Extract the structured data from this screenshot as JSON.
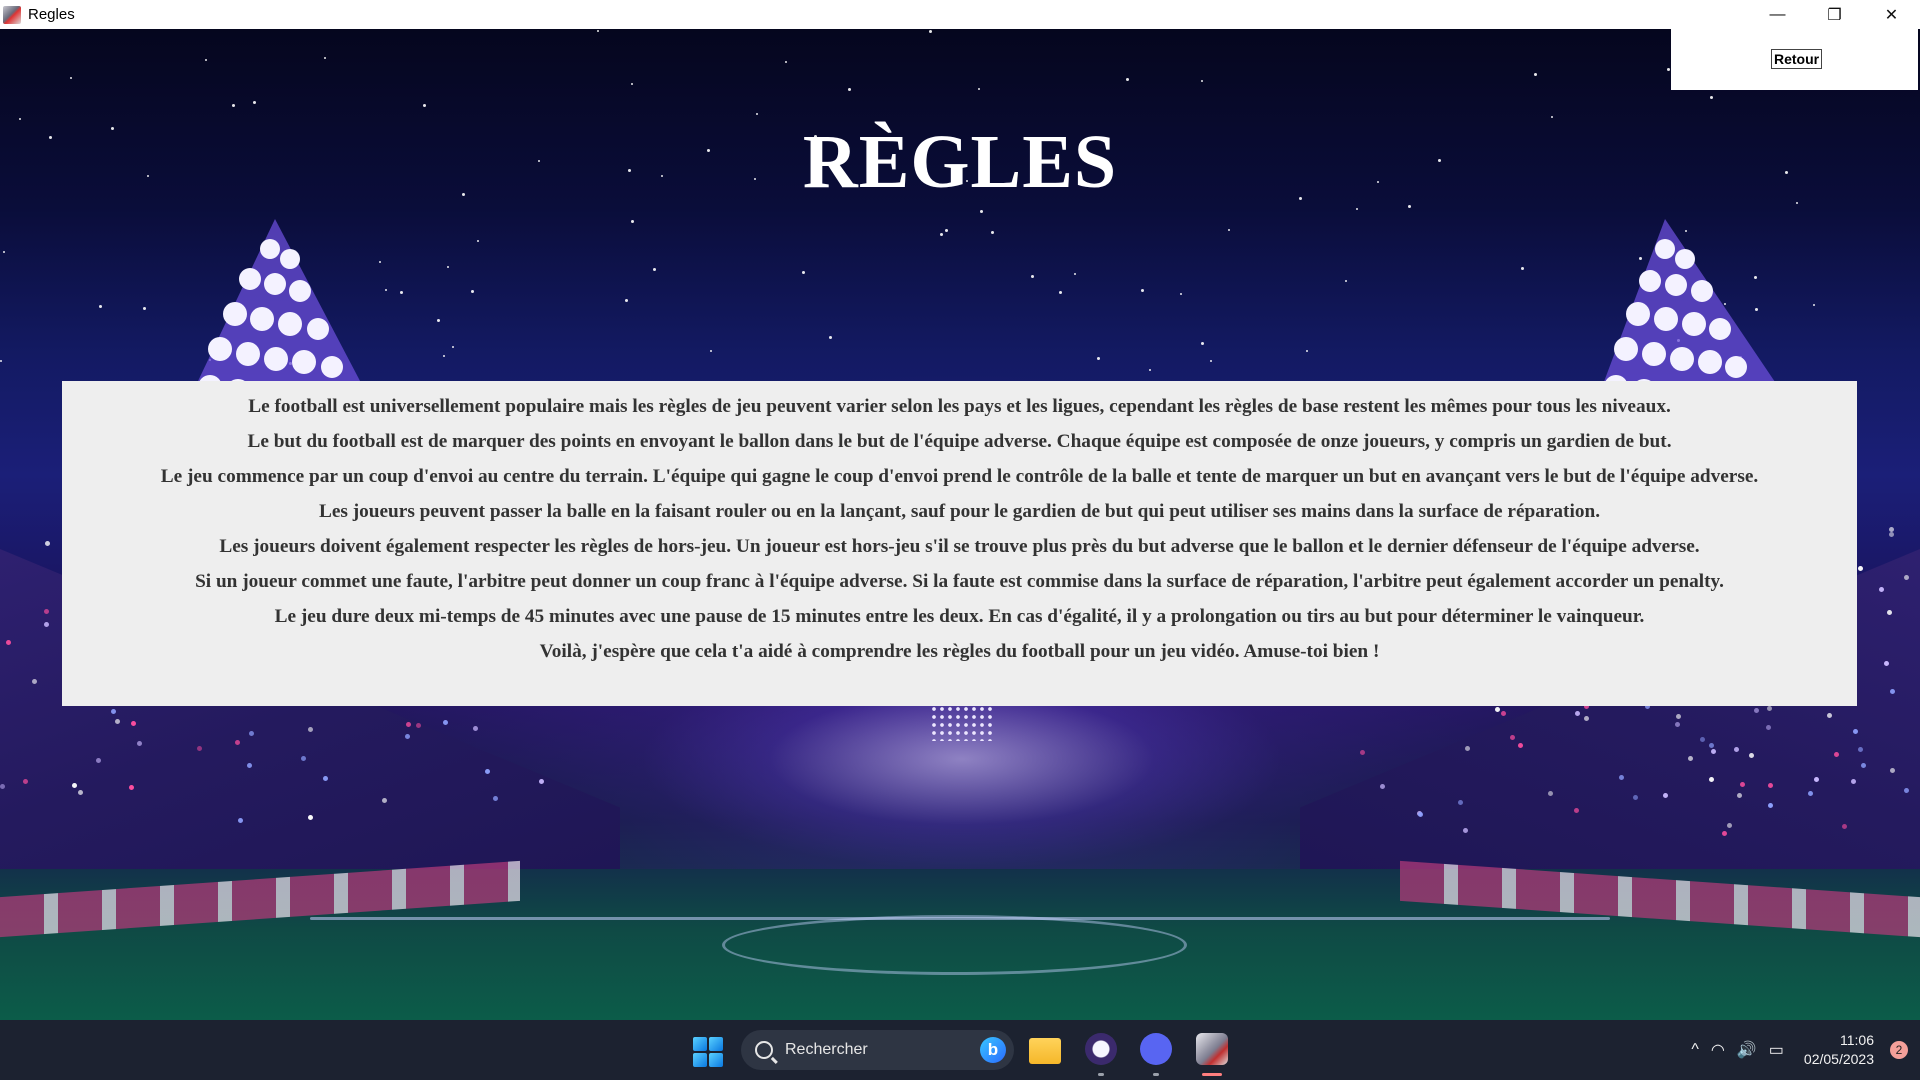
{
  "window": {
    "title": "Regles",
    "minimize_symbol": "—",
    "maximize_symbol": "❐",
    "close_symbol": "✕"
  },
  "page": {
    "title": "RÈGLES",
    "back_button_label": "Retour"
  },
  "rules": [
    "Le football est universellement populaire mais les règles de jeu peuvent varier selon les pays et les ligues, cependant les règles de base restent les mêmes pour tous les niveaux.",
    "Le but du football est de marquer des points en envoyant le ballon dans le but de l'équipe adverse. Chaque équipe est composée de onze joueurs, y compris un gardien de but.",
    "Le jeu commence par un coup d'envoi au centre du terrain. L'équipe qui gagne le coup d'envoi prend le contrôle de la balle et tente de marquer un but en avançant vers le but de l'équipe adverse.",
    "Les joueurs peuvent passer la balle en la faisant rouler ou en la lançant, sauf pour le gardien de but qui peut utiliser ses mains dans la surface de réparation.",
    "Les joueurs doivent également respecter les règles de hors-jeu. Un joueur est hors-jeu s'il se trouve plus près du but adverse que le ballon et le dernier défenseur de l'équipe adverse.",
    "Si un joueur commet une faute, l'arbitre peut donner un coup franc à l'équipe adverse. Si la faute est commise dans la surface de réparation, l'arbitre peut également accorder un penalty.",
    "Le jeu dure deux mi-temps de 45 minutes avec une pause de 15 minutes entre les deux. En cas d'égalité, il y a prolongation ou tirs au but pour déterminer le vainqueur.",
    "Voilà, j'espère que cela t'a aidé à comprendre les règles du football pour un jeu vidéo. Amuse-toi bien !"
  ],
  "taskbar": {
    "search_placeholder": "Rechercher",
    "bing_letter": "b",
    "tray_chevron": "^",
    "wifi_symbol": "◠",
    "volume_symbol": "🔊",
    "battery_symbol": "▭",
    "time": "11:06",
    "date": "02/05/2023",
    "notification_count": "2"
  },
  "colors": {
    "panel_bg": "#eeeeee",
    "panel_text": "#333333",
    "title_text": "#ffffff",
    "taskbar_bg": "#1c2230"
  }
}
